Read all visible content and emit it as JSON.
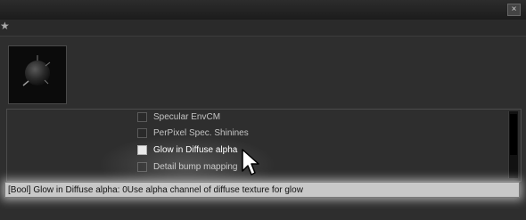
{
  "window": {
    "close_glyph": "×"
  },
  "toolbar": {
    "pin_glyph": "★"
  },
  "preview": {
    "icon": "sphere-preview-icon"
  },
  "list": {
    "items": [
      {
        "label": "Specular EnvCM",
        "checked": false
      },
      {
        "label": "PerPixel Spec. Shinines",
        "checked": false
      },
      {
        "label": "Glow in Diffuse alpha",
        "checked": false,
        "highlighted": true
      },
      {
        "label": "Detail bump mapping",
        "checked": false
      }
    ]
  },
  "status": {
    "text": "[Bool] Glow in Diffuse alpha: 0Use alpha channel of diffuse texture for glow"
  },
  "colors": {
    "panel": "#2e2e2e",
    "status_bg": "#c8c8c8",
    "text": "#c4c4c4"
  }
}
